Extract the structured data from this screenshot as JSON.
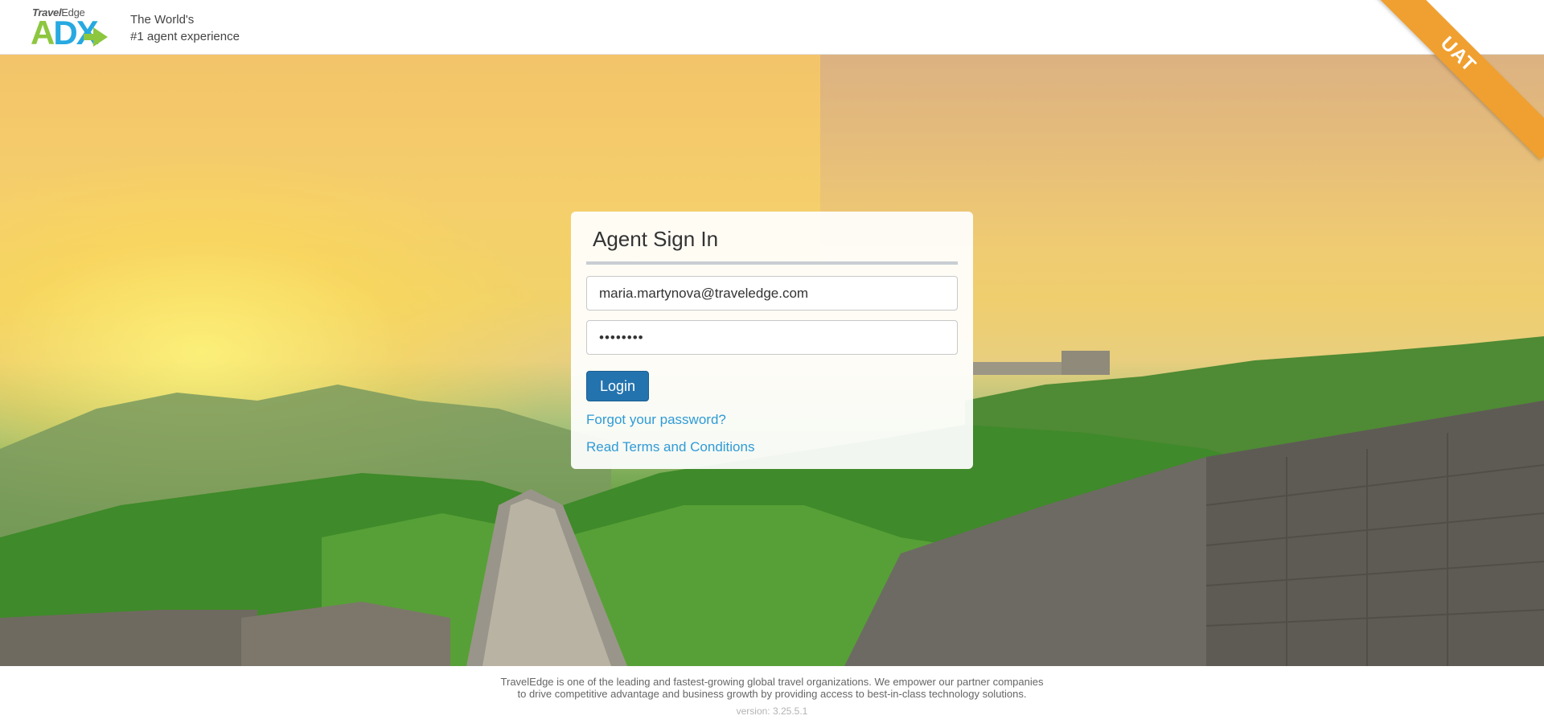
{
  "header": {
    "logo": {
      "brand_small_travel": "Travel",
      "brand_small_edge": "Edge",
      "brand_letters": {
        "a": "A",
        "d": "D",
        "x": "X"
      }
    },
    "tagline_line1": "The World's",
    "tagline_line2": "#1 agent experience",
    "environment_badge": "UAT"
  },
  "signin": {
    "title": "Agent Sign In",
    "email_value": "maria.martynova@traveledge.com",
    "password_value": "••••••••",
    "login_label": "Login",
    "forgot_link": "Forgot your password?",
    "terms_link": "Read Terms and Conditions"
  },
  "footer": {
    "line1": "TravelEdge is one of the leading and fastest-growing global travel organizations. We empower our partner companies",
    "line2": "to drive competitive advantage and business growth by providing access to best-in-class technology solutions.",
    "version": "version: 3.25.5.1"
  },
  "colors": {
    "accent_blue": "#2373ae",
    "link_blue": "#2f9bd6",
    "logo_green": "#8dc63f",
    "logo_blue": "#27a9e1",
    "ribbon_orange": "#f0a030"
  },
  "icons": [
    "traveledge-adx-logo",
    "uat-ribbon"
  ]
}
